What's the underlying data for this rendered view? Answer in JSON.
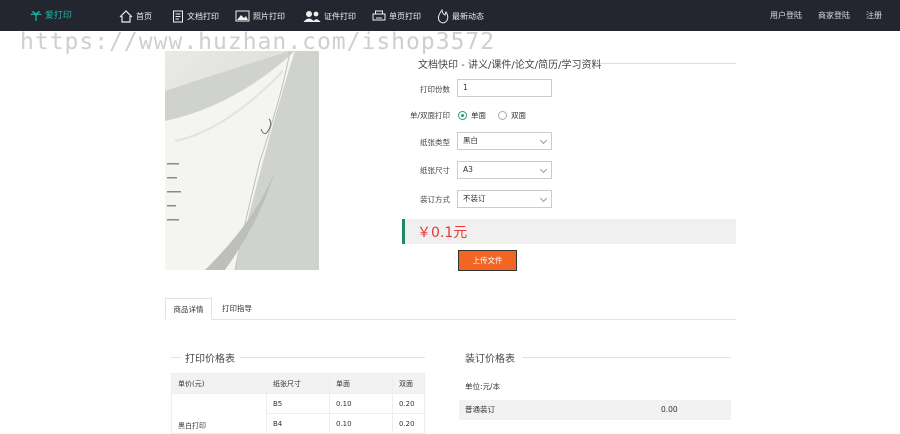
{
  "header": {
    "logo": "爱打印",
    "nav": [
      {
        "label": "首页",
        "icon": "home-icon"
      },
      {
        "label": "文档打印",
        "icon": "document-icon"
      },
      {
        "label": "照片打印",
        "icon": "photo-icon"
      },
      {
        "label": "证件打印",
        "icon": "id-card-icon"
      },
      {
        "label": "单页打印",
        "icon": "single-page-icon"
      },
      {
        "label": "最新动态",
        "icon": "fire-icon"
      }
    ],
    "right": [
      "用户登陆",
      "商家登陆",
      "注册"
    ]
  },
  "watermark": "https://www.huzhan.com/ishop3572",
  "product": {
    "title": "文档快印 - 讲义/课件/论文/简历/学习资料",
    "copies_label": "打印份数",
    "copies_value": "1",
    "duplex_label": "单/双面打印",
    "duplex_options": [
      "单面",
      "双面"
    ],
    "paper_type_label": "纸张类型",
    "paper_type_value": "黑白",
    "paper_size_label": "纸张尺寸",
    "paper_size_value": "A3",
    "binding_label": "装订方式",
    "binding_value": "不装订",
    "price": "￥0.1元",
    "upload_label": "上传文件"
  },
  "tabs": [
    "商品详情",
    "打印指导"
  ],
  "price_table": {
    "title": "打印价格表",
    "headers": [
      "单价(元)",
      "纸张尺寸",
      "单面",
      "双面"
    ],
    "rows": [
      {
        "size": "B5",
        "single": "0.10",
        "double": "0.20"
      },
      {
        "size": "B4",
        "single": "0.10",
        "double": "0.20"
      }
    ],
    "row_group": "黑白打印"
  },
  "binding_table": {
    "title": "装订价格表",
    "unit": "单位:元/本",
    "rows": [
      {
        "name": "普通装订",
        "price": "0.00"
      }
    ]
  },
  "colors": {
    "topbar": "#23262e",
    "accent": "#1e8a6a",
    "price": "#e4393c",
    "upload": "#f36523"
  }
}
